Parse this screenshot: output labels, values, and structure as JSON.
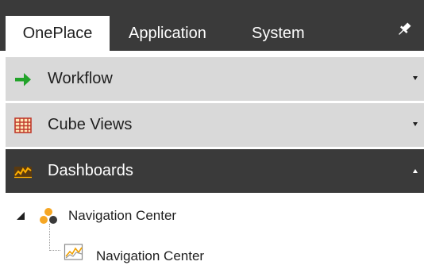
{
  "tabs": [
    {
      "label": "OnePlace",
      "active": true
    },
    {
      "label": "Application",
      "active": false
    },
    {
      "label": "System",
      "active": false
    }
  ],
  "pin_icon": "pushpin-icon",
  "panels": {
    "workflow": {
      "label": "Workflow",
      "icon": "green-arrow-right-icon",
      "state": "collapsed"
    },
    "cube_views": {
      "label": "Cube Views",
      "icon": "grid-table-icon",
      "state": "collapsed"
    },
    "dashboards": {
      "label": "Dashboards",
      "icon": "line-chart-icon",
      "state": "expanded"
    }
  },
  "tree": {
    "root": {
      "label": "Navigation Center",
      "icon": "dashboard-group-icon",
      "expanded": true
    },
    "child": {
      "label": "Navigation Center",
      "icon": "dashboard-chart-icon"
    }
  },
  "colors": {
    "dark_bar": "#3a3a3a",
    "light_bar": "#d9d9d9",
    "workflow_arrow": "#22a32a",
    "grid_icon": "#c0392b",
    "chart_icon": "#f0a000",
    "group_dot_orange": "#f5a623",
    "group_dot_dark": "#3a3a3a"
  }
}
